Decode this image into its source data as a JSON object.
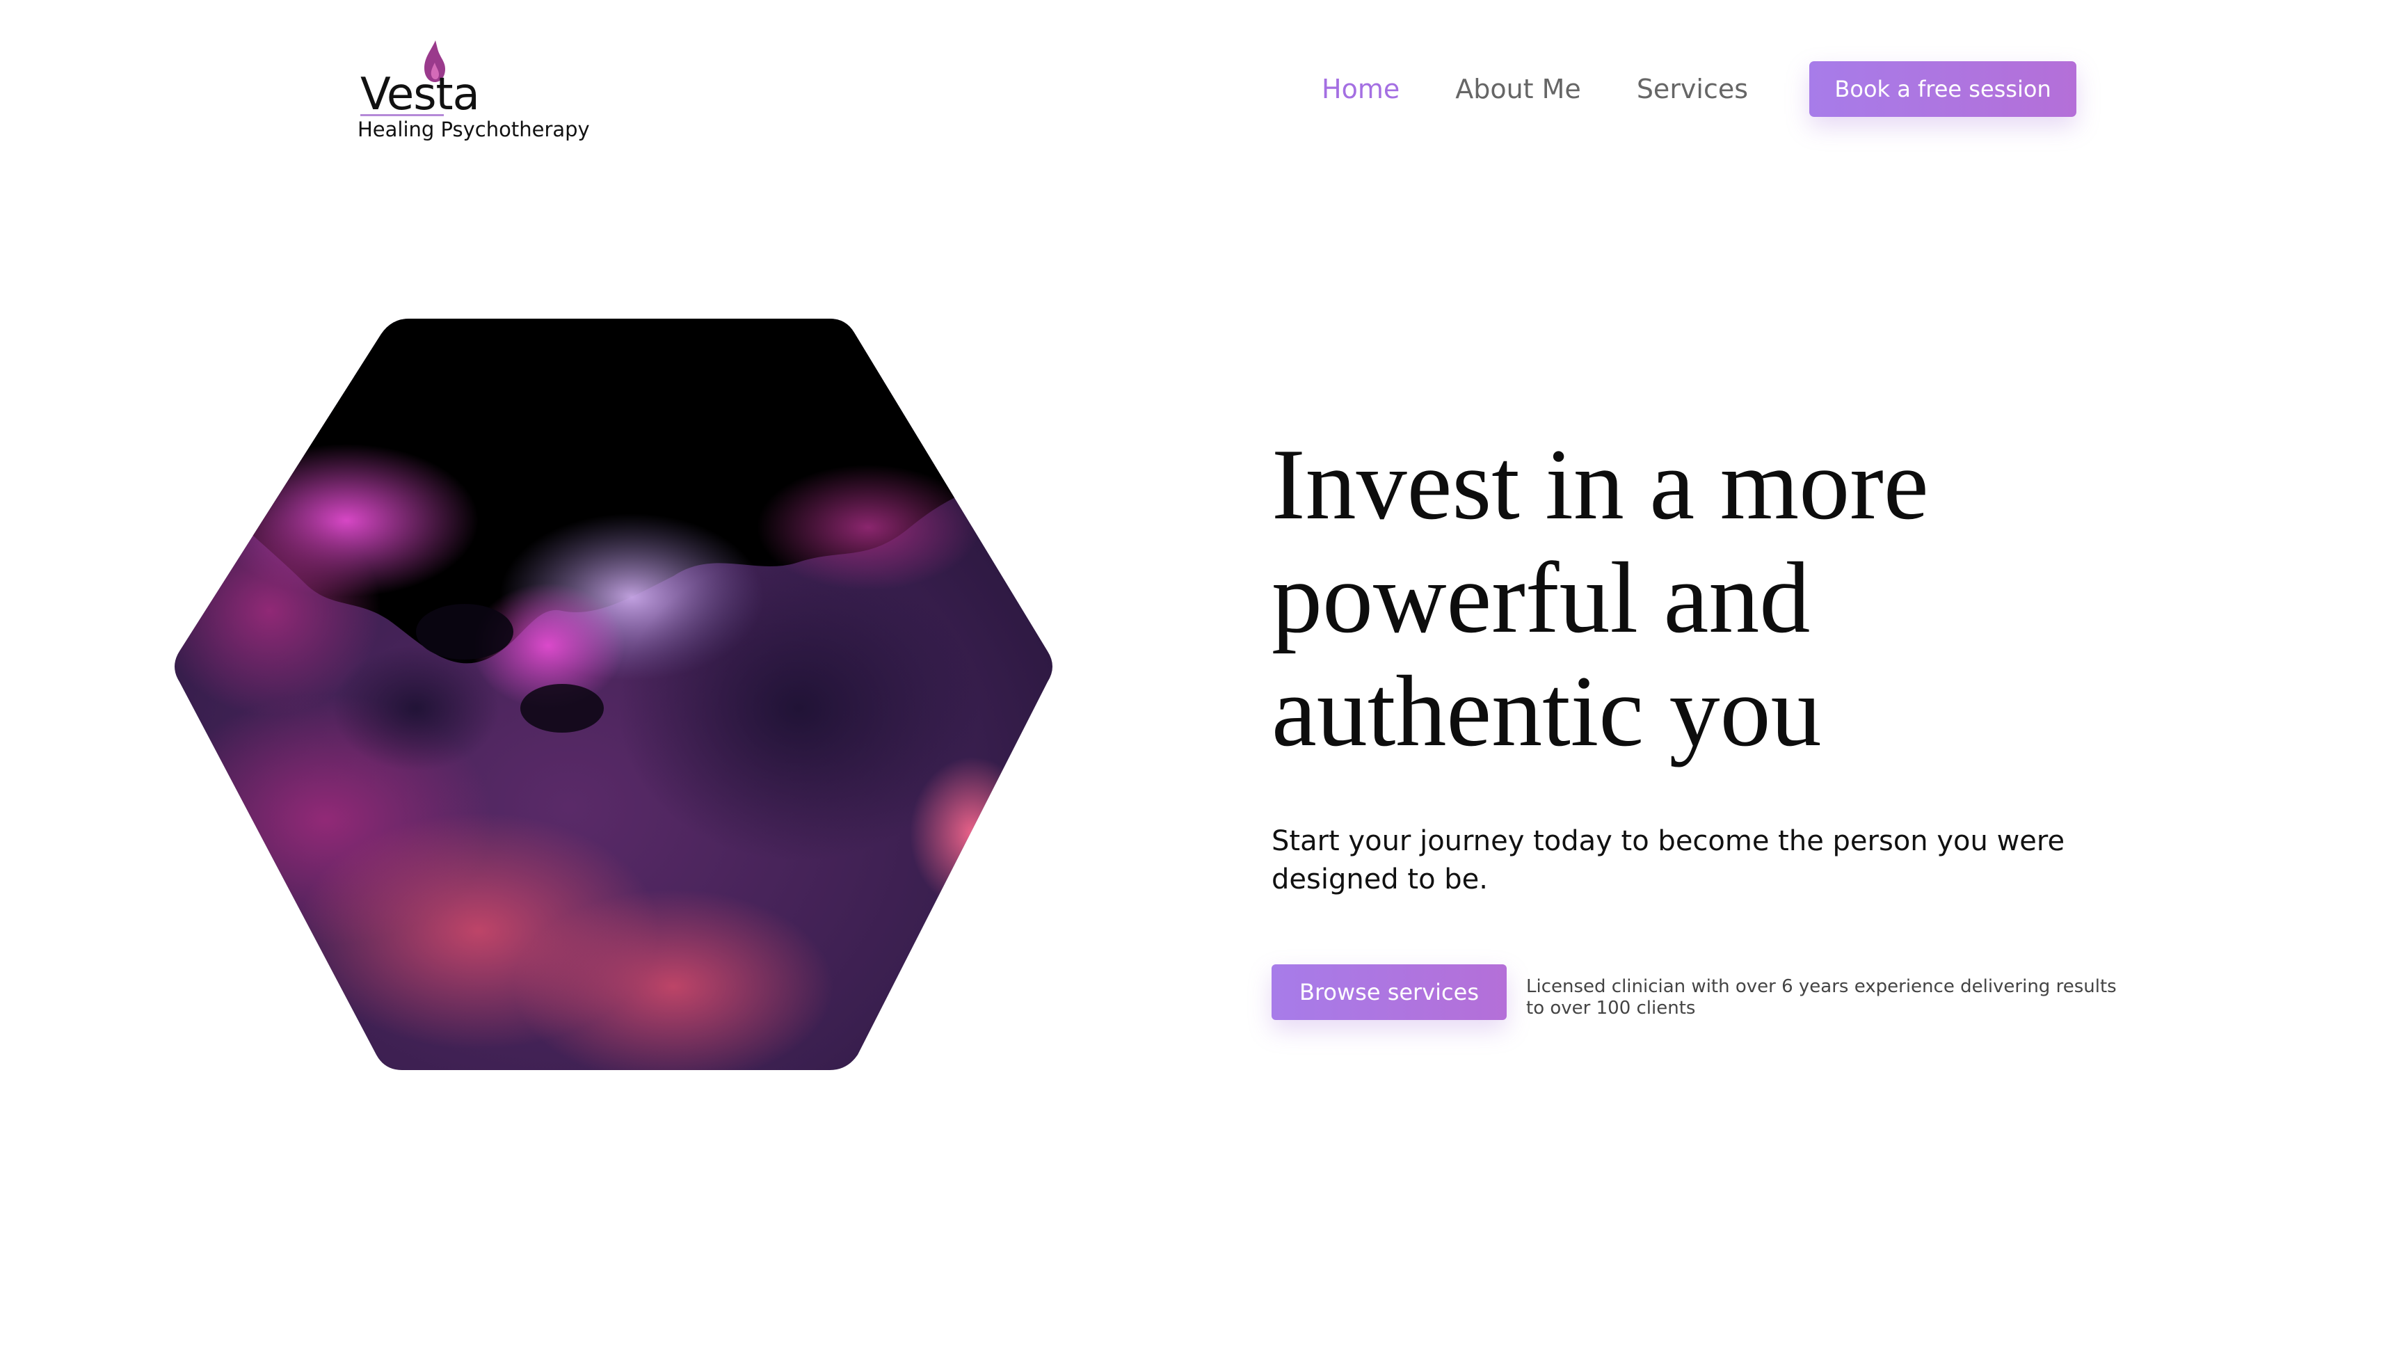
{
  "brand": {
    "name": "Vesta",
    "tagline": "Healing Psychotherapy",
    "accent_color": "#a46fe2",
    "flame_color": "#9a3a8c",
    "logo_icon": "flame-icon"
  },
  "nav": {
    "items": [
      {
        "label": "Home",
        "active": true
      },
      {
        "label": "About Me",
        "active": false
      },
      {
        "label": "Services",
        "active": false
      }
    ],
    "cta_label": "Book a free session"
  },
  "hero": {
    "image": "purple-nebula-hexagon",
    "title": "Invest in a more powerful and authentic you",
    "subtitle": "Start your journey today to become the person you were designed to be.",
    "button_label": "Browse services",
    "credential": "Licensed clinician with over 6 years experience delivering results to over 100 clients"
  }
}
